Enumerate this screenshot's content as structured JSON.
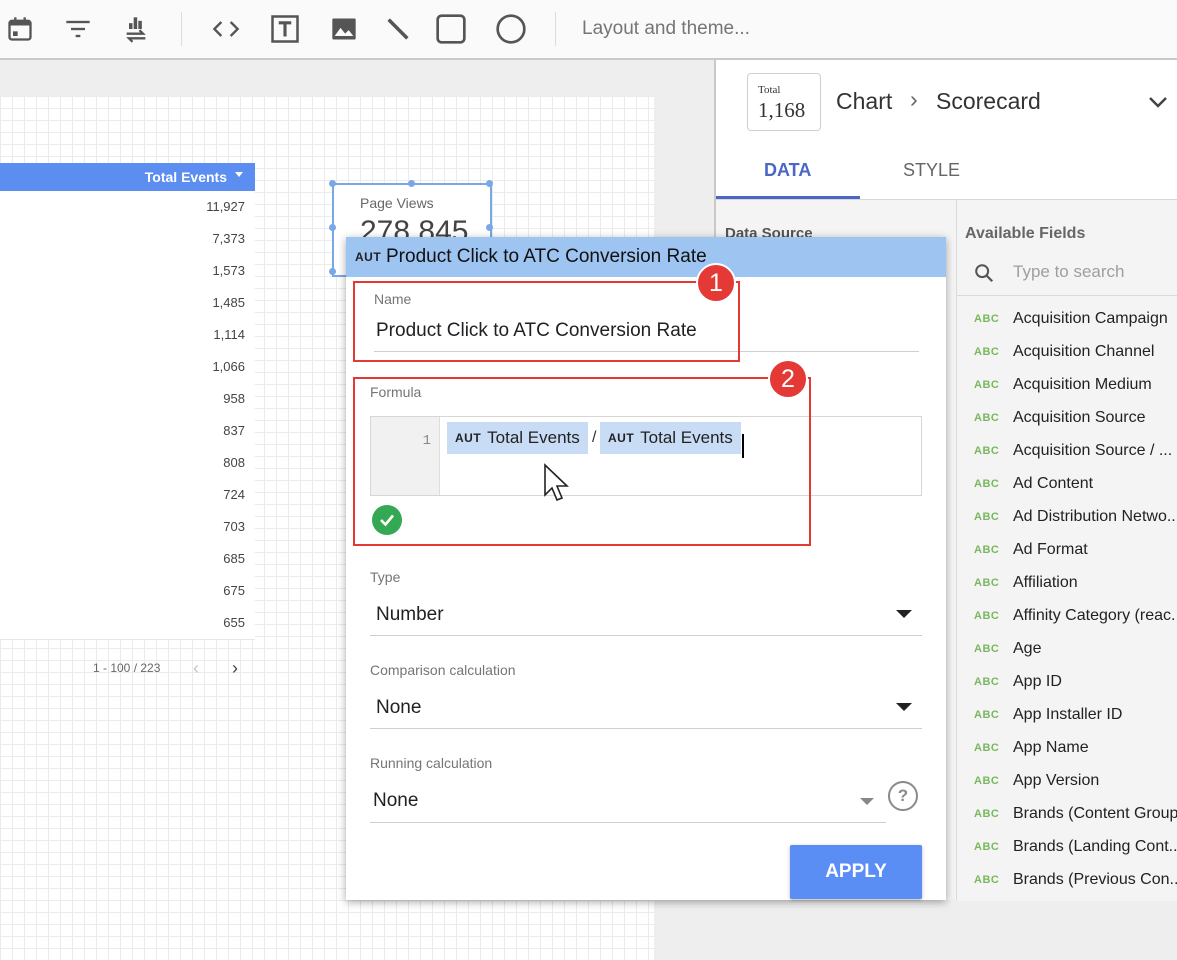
{
  "toolbar": {
    "icons": [
      "calendar-icon",
      "filter-icon",
      "data-control-icon",
      "code-icon",
      "text-icon",
      "image-icon",
      "line-icon",
      "rectangle-icon",
      "circle-icon"
    ],
    "layout_theme_label": "Layout and theme..."
  },
  "table": {
    "header_label": "Total Events",
    "rows": [
      "11,927",
      "7,373",
      "1,573",
      "1,485",
      "1,114",
      "1,066",
      "958",
      "837",
      "808",
      "724",
      "703",
      "685",
      "675",
      "655"
    ],
    "pager_text": "1 - 100 / 223"
  },
  "scorecard": {
    "label": "Page Views",
    "value": "278,845"
  },
  "dialog": {
    "type_tag": "AUT",
    "title": "Product Click to ATC Conversion Rate",
    "name_label": "Name",
    "name_value": "Product Click to ATC Conversion Rate",
    "formula_label": "Formula",
    "formula_line_number": "1",
    "formula_chip_1": "Total Events",
    "formula_operator": "/",
    "formula_chip_2": "Total Events",
    "type_label": "Type",
    "type_value": "Number",
    "comparison_label": "Comparison calculation",
    "comparison_value": "None",
    "running_label": "Running calculation",
    "running_value": "None",
    "apply_label": "APPLY",
    "help_label": "?"
  },
  "annotations": {
    "badge_1": "1",
    "badge_2": "2",
    "highlight_color": "#e53935"
  },
  "panel": {
    "chip_total_label": "Total",
    "chip_total_value": "1,168",
    "breadcrumb_chart": "Chart",
    "breadcrumb_sep": "›",
    "breadcrumb_type": "Scorecard",
    "tab_data": "DATA",
    "tab_style": "STYLE",
    "data_source_label": "Data Source",
    "available_fields_label": "Available Fields",
    "search_placeholder": "Type to search",
    "field_type_tag": "ABC",
    "fields": [
      "Acquisition Campaign",
      "Acquisition Channel",
      "Acquisition Medium",
      "Acquisition Source",
      "Acquisition Source / ...",
      "Ad Content",
      "Ad Distribution Netwo...",
      "Ad Format",
      "Affiliation",
      "Affinity Category (reac...",
      "Age",
      "App ID",
      "App Installer ID",
      "App Name",
      "App Version",
      "Brands (Content Group)",
      "Brands (Landing Cont...",
      "Brands (Previous Con..."
    ]
  },
  "colors": {
    "accent_blue": "#5a8ef4",
    "header_blue": "#9ec4f2",
    "chip_blue": "#c8dcf6",
    "success_green": "#34a853",
    "tab_active": "#4a67c6"
  }
}
